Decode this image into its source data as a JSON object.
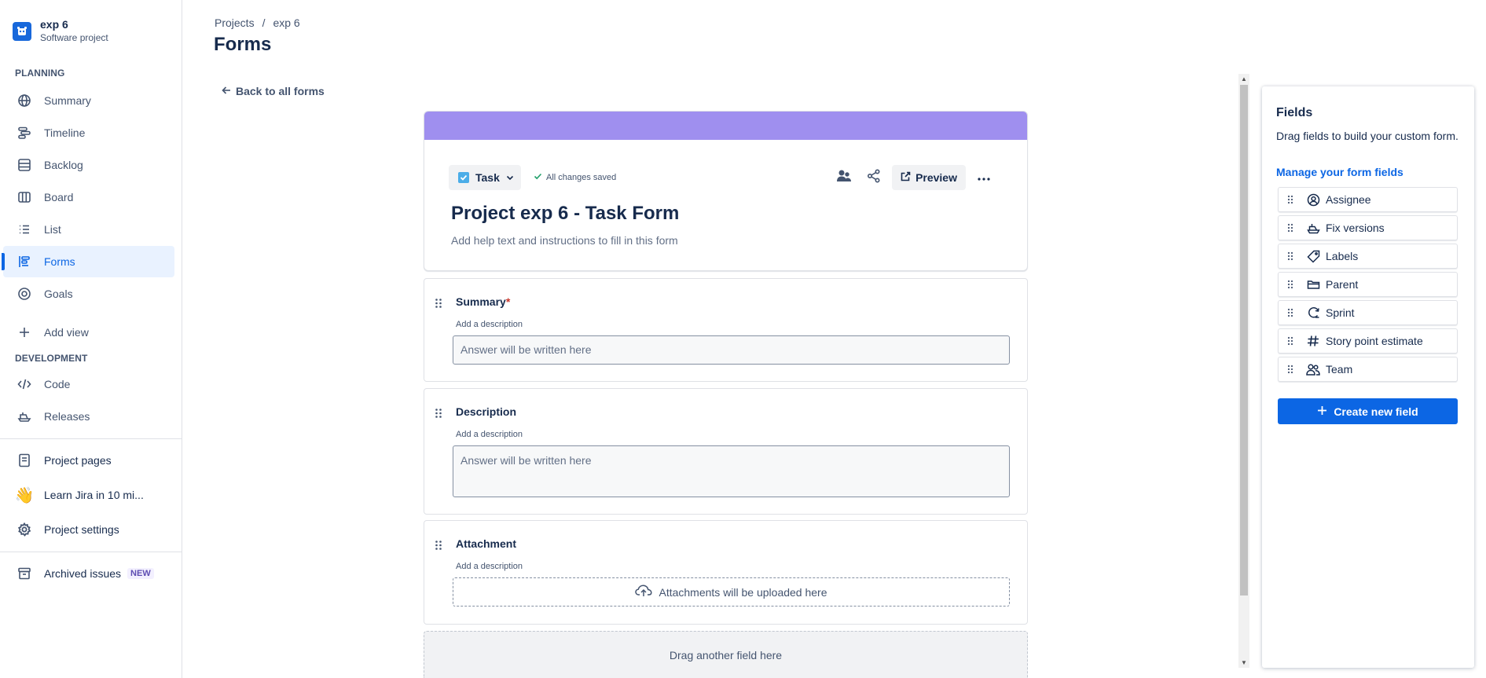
{
  "project": {
    "name": "exp 6",
    "type": "Software project"
  },
  "sidebar": {
    "planning_label": "PLANNING",
    "planning_items": [
      {
        "label": "Summary",
        "icon": "globe-icon"
      },
      {
        "label": "Timeline",
        "icon": "timeline-icon"
      },
      {
        "label": "Backlog",
        "icon": "backlog-icon"
      },
      {
        "label": "Board",
        "icon": "board-icon"
      },
      {
        "label": "List",
        "icon": "list-icon"
      },
      {
        "label": "Forms",
        "icon": "forms-icon",
        "active": true
      },
      {
        "label": "Goals",
        "icon": "goals-icon"
      }
    ],
    "add_view": "Add view",
    "development_label": "DEVELOPMENT",
    "development_items": [
      {
        "label": "Code",
        "icon": "code-icon"
      },
      {
        "label": "Releases",
        "icon": "releases-icon"
      }
    ],
    "project_pages": "Project pages",
    "learn": "Learn Jira in 10 mi...",
    "project_settings": "Project settings",
    "archived": "Archived issues",
    "archived_badge": "NEW"
  },
  "header": {
    "breadcrumb": [
      "Projects",
      "/",
      "exp 6"
    ],
    "title": "Forms"
  },
  "back_link": "Back to all forms",
  "form": {
    "banner_color": "#9f8fef",
    "issue_type": "Task",
    "save_status": "All changes saved",
    "preview_label": "Preview",
    "title": "Project exp 6 - Task Form",
    "help_text": "Add help text and instructions to fill in this form",
    "fields": [
      {
        "label": "Summary",
        "required_mark": "*",
        "desc": "Add a description",
        "placeholder": "Answer will be written here"
      },
      {
        "label": "Description",
        "desc": "Add a description",
        "placeholder": "Answer will be written here"
      },
      {
        "label": "Attachment",
        "desc": "Add a description",
        "placeholder": "Attachments will be uploaded here"
      }
    ],
    "drop_zone": "Drag another field here"
  },
  "fields_panel": {
    "title": "Fields",
    "description": "Drag fields to build your custom form.",
    "manage_link": "Manage your form fields",
    "items": [
      {
        "label": "Assignee",
        "icon": "person-icon"
      },
      {
        "label": "Fix versions",
        "icon": "ship-icon"
      },
      {
        "label": "Labels",
        "icon": "tag-icon"
      },
      {
        "label": "Parent",
        "icon": "folder-icon"
      },
      {
        "label": "Sprint",
        "icon": "sprint-icon"
      },
      {
        "label": "Story point estimate",
        "icon": "hash-icon"
      },
      {
        "label": "Team",
        "icon": "team-icon"
      }
    ],
    "create_button": "Create new field"
  },
  "colors": {
    "accent": "#0c66e4",
    "active_bg": "#e9f2ff",
    "banner": "#9f8fef"
  }
}
